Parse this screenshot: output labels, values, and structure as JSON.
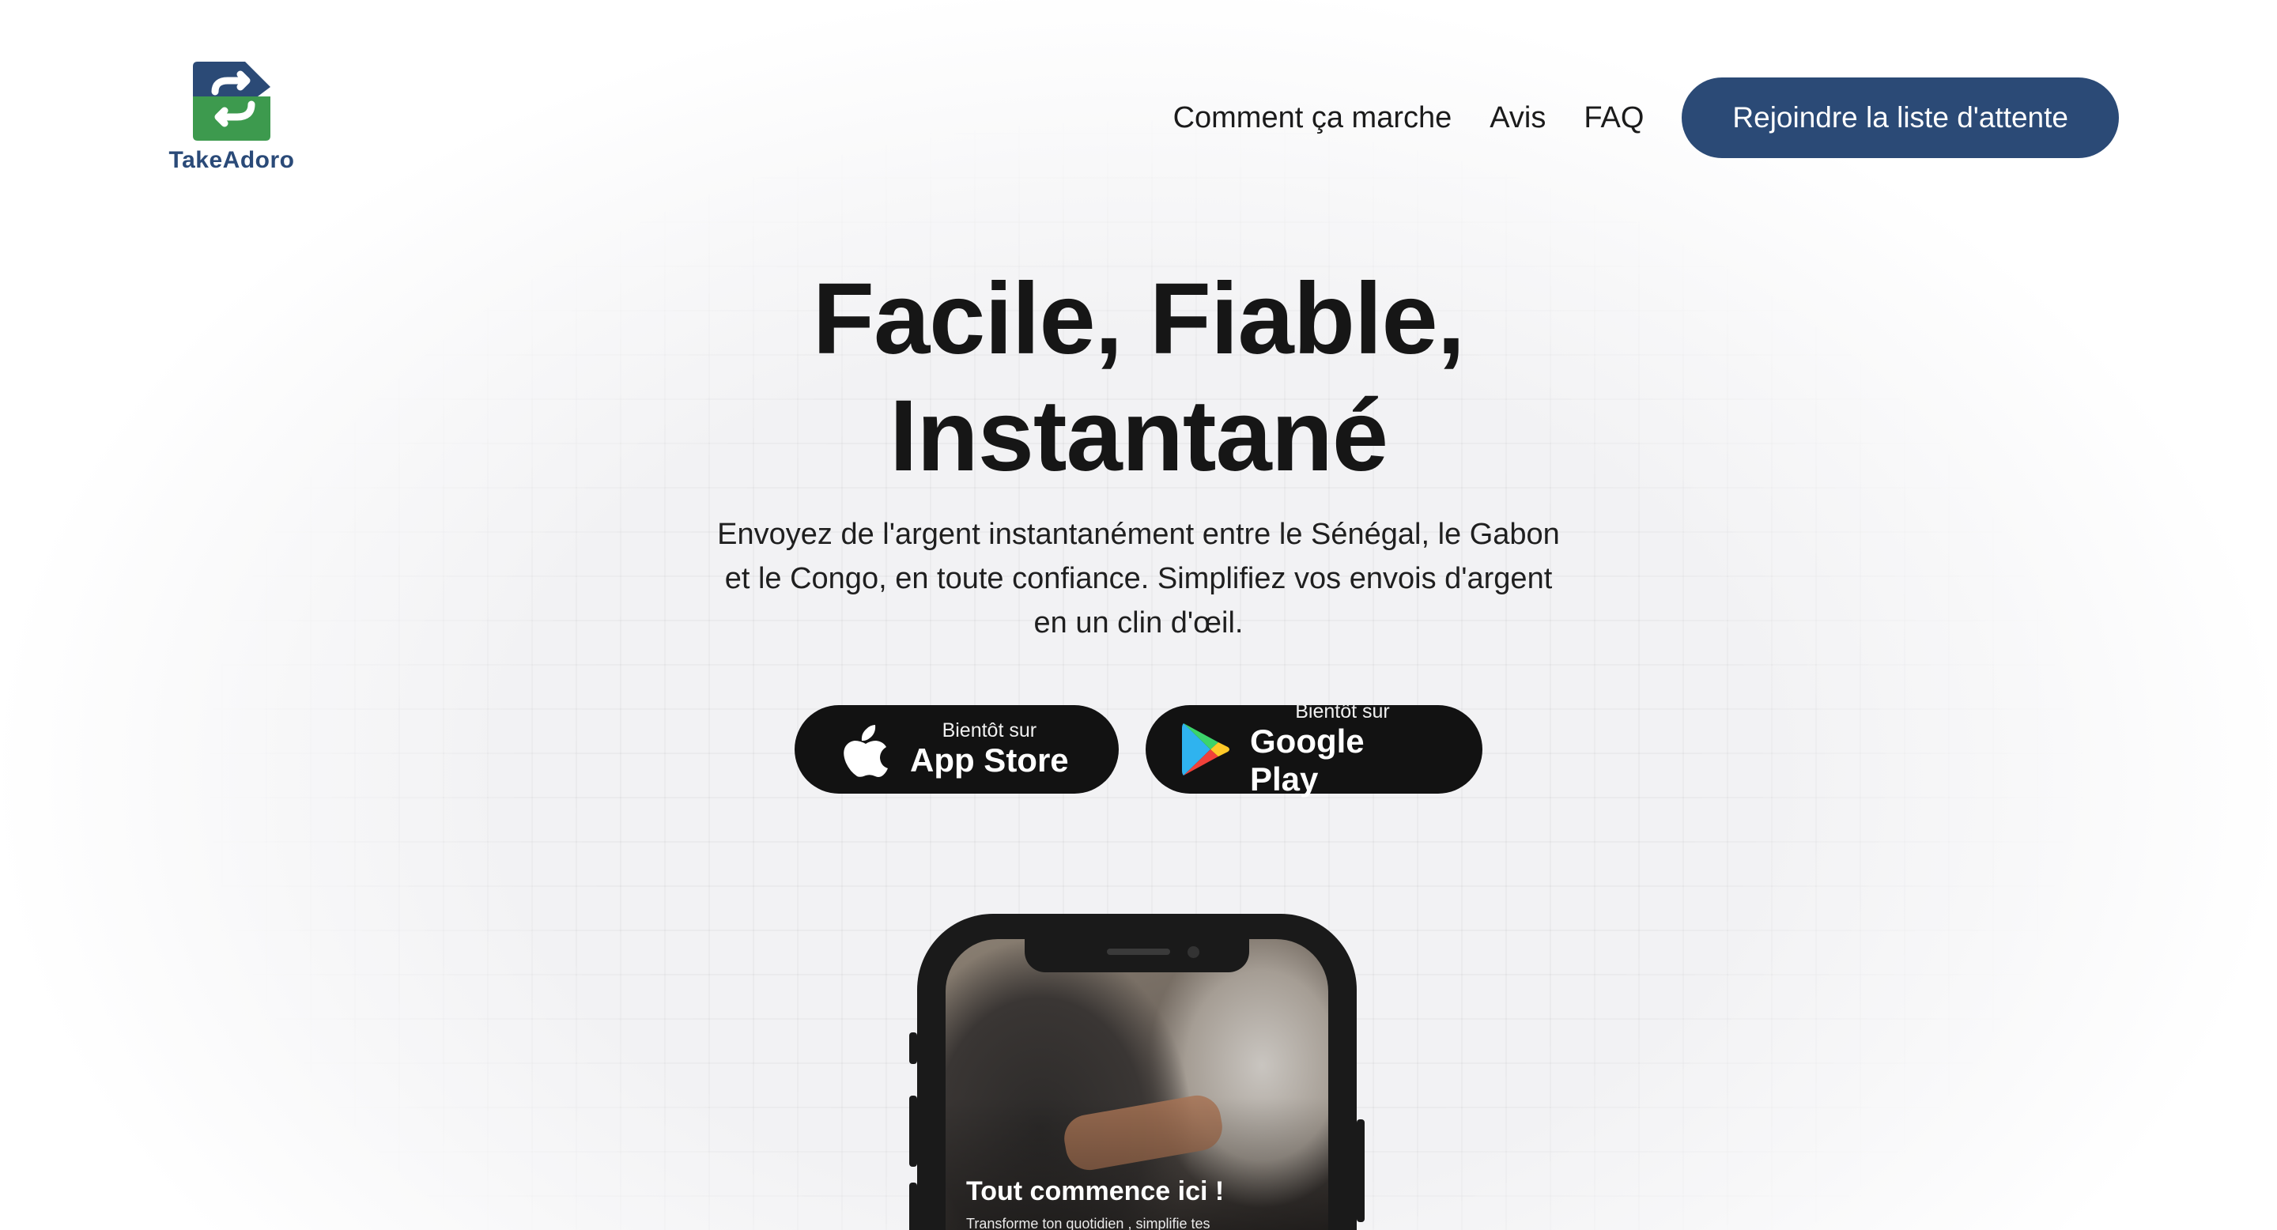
{
  "brand": {
    "name": "TakeAdoro",
    "logo_icon": "exchange-arrows-icon",
    "colors": {
      "blue": "#2b4a76",
      "green": "#3d9a4e"
    }
  },
  "nav": {
    "items": [
      "Comment ça marche",
      "Avis",
      "FAQ"
    ],
    "cta_label": "Rejoindre la liste d'attente"
  },
  "hero": {
    "title_line1": "Facile, Fiable,",
    "title_line2": "Instantané",
    "subtitle": "Envoyez de l'argent instantanément entre le Sénégal, le Gabon et le Congo, en toute confiance. Simplifiez vos envois d'argent en un clin d'œil."
  },
  "stores": {
    "apple": {
      "small": "Bientôt sur",
      "big": "App Store",
      "icon": "apple-icon"
    },
    "google": {
      "small": "Bientôt sur",
      "big": "Google Play",
      "icon": "google-play-icon"
    }
  },
  "phone": {
    "screen_title": "Tout commence ici !",
    "screen_subtitle": "Transforme ton quotidien , simplifie tes"
  }
}
